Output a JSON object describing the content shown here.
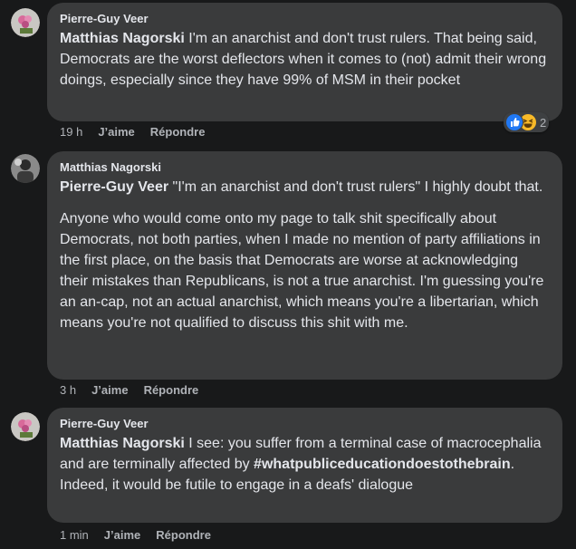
{
  "comments": [
    {
      "author": "Pierre-Guy Veer",
      "mention": "Matthias Nagorski",
      "text": " I'm an anarchist and don't trust rulers. That being said, Democrats are the worst deflectors when it comes to (not) admit their wrong doings, especially since they have 99% of MSM in their pocket",
      "time": "19 h",
      "like_label": "J’aime",
      "reply_label": "Répondre",
      "reactions": {
        "icons": [
          "like-icon",
          "haha-icon"
        ],
        "count": "2"
      }
    },
    {
      "author": "Matthias Nagorski",
      "mention": "Pierre-Guy Veer",
      "text": " \"I'm an anarchist and don't trust rulers\" I highly doubt that.",
      "paragraph2": "Anyone who would come onto my page to talk shit specifically about Democrats, not both parties, when I made no mention of party affiliations in the first place, on the basis that Democrats are worse at acknowledging their mistakes than Republicans, is not a true anarchist. I'm guessing you're an an-cap, not an actual anarchist, which means you're a libertarian, which means you're not qualified to discuss this shit with me.",
      "time": "3 h",
      "like_label": "J’aime",
      "reply_label": "Répondre"
    },
    {
      "author": "Pierre-Guy Veer",
      "mention": "Matthias Nagorski",
      "text": " I see: you suffer from a terminal case of macrocephalia and are terminally affected by ",
      "hashtag": "#whatpubliceducationdoestothebrain",
      "text_after": ". Indeed, it would be futile to engage in a deafs' dialogue",
      "time": "1 min",
      "like_label": "J’aime",
      "reply_label": "Répondre"
    }
  ],
  "colors": {
    "background": "#18191a",
    "bubble": "#3a3b3c",
    "text": "#e4e6eb",
    "secondary": "#b0b3b8",
    "like_blue": "#2078f4",
    "haha_yellow": "#f7b928"
  }
}
